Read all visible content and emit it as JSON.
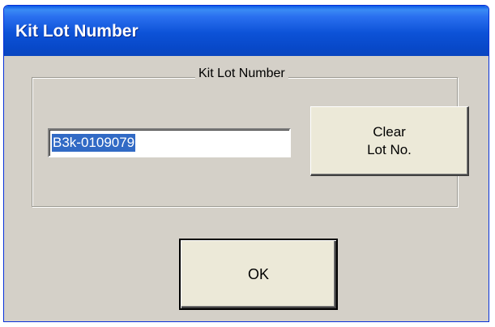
{
  "window": {
    "title": "Kit Lot Number"
  },
  "group": {
    "legend": "Kit Lot Number"
  },
  "lot_input": {
    "value": "B3k-0109079",
    "selected": true
  },
  "clear_button": {
    "label_line1": "Clear",
    "label_line2": "Lot No."
  },
  "ok_button": {
    "label": "OK"
  },
  "colors": {
    "titlebar": "#0c52d7",
    "dialog_background": "#d4d0c8",
    "button_face": "#ece9d8",
    "selection": "#316ac5"
  }
}
